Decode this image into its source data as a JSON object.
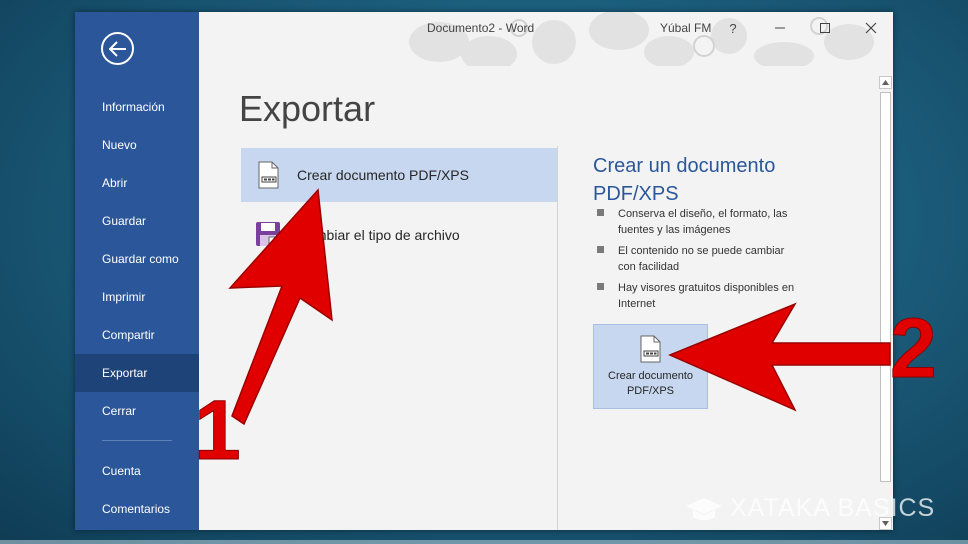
{
  "window": {
    "title": "Documento2  -  Word",
    "user": "Yúbal FM",
    "help": "?",
    "min": "—",
    "max": "☐",
    "close": "✕"
  },
  "sidebar": {
    "items": [
      {
        "label": "Información"
      },
      {
        "label": "Nuevo"
      },
      {
        "label": "Abrir"
      },
      {
        "label": "Guardar"
      },
      {
        "label": "Guardar como"
      },
      {
        "label": "Imprimir"
      },
      {
        "label": "Compartir"
      },
      {
        "label": "Exportar",
        "active": true
      },
      {
        "label": "Cerrar"
      },
      {
        "label": "Cuenta"
      },
      {
        "label": "Comentarios"
      }
    ]
  },
  "main": {
    "title": "Exportar",
    "options": [
      {
        "label": "Crear documento PDF/XPS",
        "icon": "pdf-document-icon"
      },
      {
        "label": "Cambiar el tipo de archivo",
        "icon": "save-floppy-icon"
      }
    ],
    "detail": {
      "title": "Crear un documento PDF/XPS",
      "bullets": [
        "Conserva el diseño, el formato, las fuentes y las imágenes",
        "El contenido no se puede cambiar con facilidad",
        "Hay visores gratuitos disponibles en Internet"
      ],
      "button_label": "Crear documento PDF/XPS"
    }
  },
  "annotations": {
    "number_1": "1",
    "number_2": "2",
    "arrow_color": "#e10000"
  },
  "watermark": {
    "text": "XATAKA BASICS"
  },
  "colors": {
    "sidebar": "#2b579a",
    "sidebar_active": "#1e4379",
    "selected": "#c6d7ef",
    "accent_text": "#2b579a"
  }
}
